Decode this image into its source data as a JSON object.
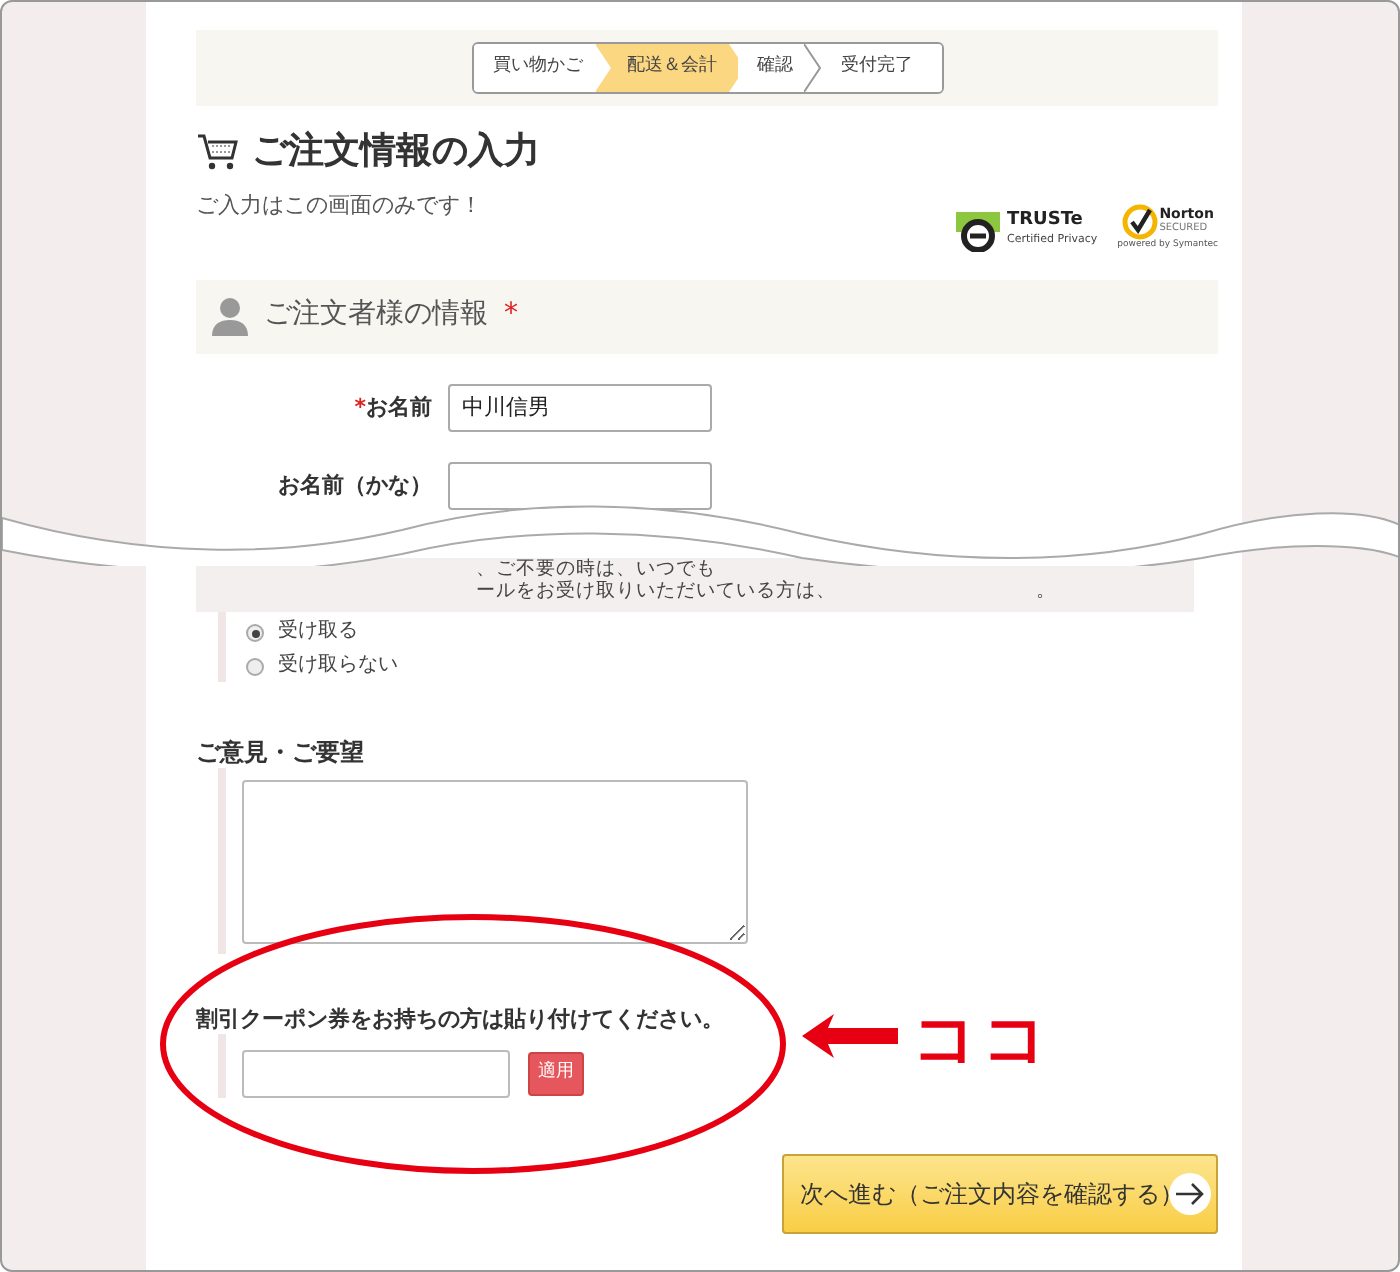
{
  "steps": [
    {
      "label": "買い物かご",
      "selected": false
    },
    {
      "label": "配送＆会計",
      "selected": true
    },
    {
      "label": "確認",
      "selected": false
    },
    {
      "label": "受付完了",
      "selected": false
    }
  ],
  "page_title": "ご注文情報の入力",
  "notice": "ご入力はこの画面のみです！",
  "badges": [
    {
      "kind": "truste",
      "name": "TRUSTe",
      "caption": "Certified Privacy"
    },
    {
      "kind": "norton",
      "name": "Norton",
      "caption": "SECURED",
      "footer": "powered by Symantec"
    }
  ],
  "section": {
    "title": "ご注文者様の情報",
    "required_mark": "*"
  },
  "fields": [
    {
      "label": "お名前",
      "required": true,
      "required_mark": "*",
      "value": "中川信男"
    },
    {
      "label": "お名前（かな）",
      "required": false
    }
  ],
  "mail_notice": {
    "lines": [
      "、ご不要の時は、いつでも",
      "ールをお受け取りいただいている方は、"
    ],
    "tail": "。"
  },
  "mail_options": [
    {
      "label": "受け取る",
      "selected": true
    },
    {
      "label": "受け取らない",
      "selected": false
    }
  ],
  "comments": {
    "label": "ご意見・ご要望"
  },
  "coupon": {
    "label": "割引クーポン券をお持ちの方は貼り付けてください。",
    "button": "適用"
  },
  "next_button": "次へ進む（ご注文内容を確認する）",
  "annotation": {
    "text": "ココ"
  }
}
